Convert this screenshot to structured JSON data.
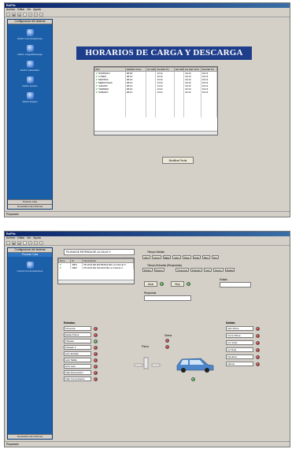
{
  "window1": {
    "title": "ExiPlic",
    "menu": [
      "Archivo",
      "Editar",
      "Ver",
      "Ayuda"
    ],
    "toolbar": [
      "□",
      "▣",
      "▤",
      "·",
      "↶",
      "↷",
      "?"
    ],
    "sidebar": {
      "header": "Configuracion del sistema",
      "items": [
        {
          "label": "Definir Comunicaciones"
        },
        {
          "label": "Definir Carga/Descarga"
        },
        {
          "label": "Definir Calendario"
        },
        {
          "label": "Definir Horario"
        },
        {
          "label": "Definir Equipo"
        }
      ],
      "footer1": "Proceso Cola",
      "footer2": "Generacion de Informes"
    },
    "banner": "HORARIOS DE CARGA Y DESCARGA",
    "table": {
      "columns": [
        "Dia",
        "Habilitar Inicio",
        "Ha Hab",
        "Deshab Fin",
        "Ha Hab",
        "Ha Hab Inicio",
        "Deshab Fin"
      ],
      "rows": [
        [
          "DOMINGO",
          "08:00",
          "",
          "13:11",
          "",
          "19:12",
          "19:13"
        ],
        [
          "LUNES",
          "08:10",
          "",
          "13:11",
          "",
          "19:12",
          "19:13"
        ],
        [
          "MARTES",
          "08:10",
          "",
          "13:11",
          "",
          "19:12",
          "19:13"
        ],
        [
          "MIERCOLES",
          "08:10",
          "",
          "13:11",
          "",
          "19:12",
          "19:13"
        ],
        [
          "JUEVES",
          "08:10",
          "",
          "13:11",
          "",
          "19:12",
          "19:13"
        ],
        [
          "VIERNES",
          "08:10",
          "",
          "13:11",
          "",
          "19:12",
          "19:13"
        ],
        [
          "SABADO",
          "08:10",
          "",
          "13:11",
          "",
          "19:12",
          "19:13"
        ]
      ]
    },
    "modify_button": "Modificar Fecha",
    "status": "Preparado"
  },
  "window2": {
    "title": "ExiPlic",
    "menu": [
      "Archivo",
      "Editar",
      "Ver",
      "Ayuda"
    ],
    "toolbar": [
      "□",
      "▣",
      "▤",
      "·",
      "↶",
      "↷",
      "?"
    ],
    "sidebar": {
      "header": "Configuracion del sistema",
      "sub": "Proceso Cola",
      "items": [
        {
          "label": "Control Comunicaciones"
        }
      ],
      "footer": "Generacion de Informes"
    },
    "device_field": "PILONA DE ENTRADA DE LA CALLE X",
    "list": {
      "columns": [
        "Num.",
        "Id",
        "Descripcion"
      ],
      "rows": [
        [
          "3001",
          "PILONA DE ENTRADA DE LA CALLE X"
        ],
        [
          "3002",
          "PILONA DE SALIDA DE LA CALLE X"
        ]
      ]
    },
    "tiempo_salidas_label": "Tiempo Salidas",
    "salidas_buttons": [
      "Abrir",
      "Cerrar",
      "Bajar",
      "Subir",
      "Parar",
      "Desb",
      "Bloq",
      "Test"
    ],
    "tiempo_entradas_label": "Tiempo Entradas (Respuestas)",
    "entradas_buttons": [
      "Estado",
      "Espera"
    ],
    "entradas_buttons2": [
      "Presencia",
      "Pulsador",
      "Lazo",
      "Sensor",
      "Estado"
    ],
    "estado_button": "Estado",
    "info_button": "Info",
    "state_label": "Estado",
    "respuesta_label": "Respuesta",
    "inicio_button": "Inicio",
    "stop_button": "Stop",
    "entradas_title": "Entradas:",
    "entradas": [
      "Presencia",
      "Estado Pilona",
      "Pulsador",
      "Pulsador 2",
      "Lazo Entrada",
      "Lazo Salida",
      "Error Lazo",
      "Fallo Alimentacion",
      "Fallo Comunicacion"
    ],
    "salidas_title": "Salidas:",
    "salidas": [
      "Abrir Pilona",
      "Cerrar Pilona",
      "Luz Verde",
      "Luz Roja",
      "Semaforo",
      "Alarma"
    ],
    "pilona_label": "Pilona",
    "sirena_label": "Sirena",
    "status": "Preparado"
  }
}
